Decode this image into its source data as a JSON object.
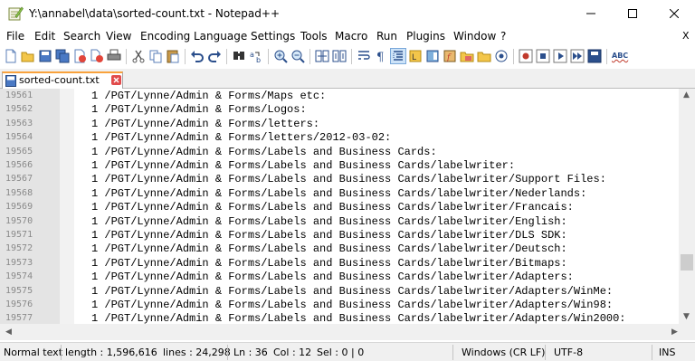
{
  "window": {
    "title": "Y:\\annabel\\data\\sorted-count.txt - Notepad++"
  },
  "menu": {
    "items": [
      "File",
      "Edit",
      "Search",
      "View",
      "Encoding",
      "Language",
      "Settings",
      "Tools",
      "Macro",
      "Run",
      "Plugins",
      "Window",
      "?"
    ],
    "close_glyph": "X"
  },
  "toolbar": {
    "icons": [
      "new-file-icon",
      "open-file-icon",
      "save-icon",
      "save-all-icon",
      "close-file-icon",
      "close-all-icon",
      "print-icon",
      "cut-icon",
      "copy-icon",
      "paste-icon",
      "undo-icon",
      "redo-icon",
      "find-icon",
      "replace-icon",
      "zoom-in-icon",
      "zoom-out-icon",
      "sync-vertical-icon",
      "sync-horizontal-icon",
      "word-wrap-icon",
      "show-all-chars-icon",
      "indent-guide-icon",
      "language-icon",
      "doc-map-icon",
      "function-list-icon",
      "folder-workspace-icon",
      "monitoring-icon",
      "record-macro-icon",
      "stop-macro-icon",
      "play-macro-icon",
      "run-macro-multiple-icon",
      "save-macro-icon",
      "spell-check-icon"
    ],
    "spell_label": "ABC"
  },
  "tabs": [
    {
      "label": "sorted-count.txt",
      "icon": "file-saved-icon",
      "active": true
    }
  ],
  "editor": {
    "lines": [
      {
        "num": "19561",
        "text": "1 /PGT/Lynne/Admin & Forms/Maps etc:"
      },
      {
        "num": "19562",
        "text": "1 /PGT/Lynne/Admin & Forms/Logos:"
      },
      {
        "num": "19563",
        "text": "1 /PGT/Lynne/Admin & Forms/letters:"
      },
      {
        "num": "19564",
        "text": "1 /PGT/Lynne/Admin & Forms/letters/2012-03-02:"
      },
      {
        "num": "19565",
        "text": "1 /PGT/Lynne/Admin & Forms/Labels and Business Cards:"
      },
      {
        "num": "19566",
        "text": "1 /PGT/Lynne/Admin & Forms/Labels and Business Cards/labelwriter:"
      },
      {
        "num": "19567",
        "text": "1 /PGT/Lynne/Admin & Forms/Labels and Business Cards/labelwriter/Support Files:"
      },
      {
        "num": "19568",
        "text": "1 /PGT/Lynne/Admin & Forms/Labels and Business Cards/labelwriter/Nederlands:"
      },
      {
        "num": "19569",
        "text": "1 /PGT/Lynne/Admin & Forms/Labels and Business Cards/labelwriter/Francais:"
      },
      {
        "num": "19570",
        "text": "1 /PGT/Lynne/Admin & Forms/Labels and Business Cards/labelwriter/English:"
      },
      {
        "num": "19571",
        "text": "1 /PGT/Lynne/Admin & Forms/Labels and Business Cards/labelwriter/DLS SDK:"
      },
      {
        "num": "19572",
        "text": "1 /PGT/Lynne/Admin & Forms/Labels and Business Cards/labelwriter/Deutsch:"
      },
      {
        "num": "19573",
        "text": "1 /PGT/Lynne/Admin & Forms/Labels and Business Cards/labelwriter/Bitmaps:"
      },
      {
        "num": "19574",
        "text": "1 /PGT/Lynne/Admin & Forms/Labels and Business Cards/labelwriter/Adapters:"
      },
      {
        "num": "19575",
        "text": "1 /PGT/Lynne/Admin & Forms/Labels and Business Cards/labelwriter/Adapters/WinMe:"
      },
      {
        "num": "19576",
        "text": "1 /PGT/Lynne/Admin & Forms/Labels and Business Cards/labelwriter/Adapters/Win98:"
      },
      {
        "num": "19577",
        "text": "1 /PGT/Lynne/Admin & Forms/Labels and Business Cards/labelwriter/Adapters/Win2000:"
      }
    ],
    "scroll_position_fraction": 0.8
  },
  "status": {
    "type": "Normal text",
    "length": "length : 1,596,616",
    "lines": "lines : 24,298",
    "ln": "Ln : 36",
    "col": "Col : 12",
    "sel": "Sel : 0 | 0",
    "eol": "Windows (CR LF)",
    "encoding": "UTF-8",
    "mode": "INS"
  }
}
